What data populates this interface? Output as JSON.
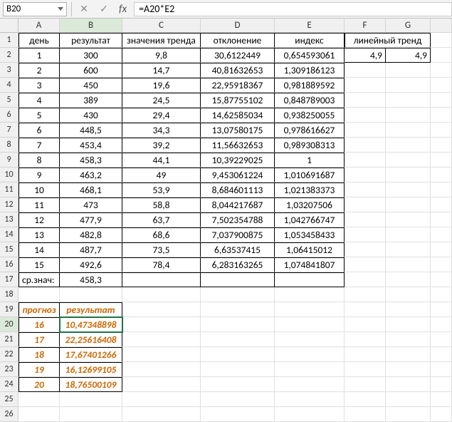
{
  "namebox": "B20",
  "fx_symbol": "fx",
  "cancel_icon": "✕",
  "confirm_icon": "✓",
  "formula": "=A20*E2",
  "col_letters": [
    "A",
    "B",
    "C",
    "D",
    "E",
    "F",
    "G",
    ""
  ],
  "header_row": [
    "день",
    "результат",
    "значения тренда",
    "отклонение",
    "индекс",
    "линейный тренд",
    ""
  ],
  "rows": [
    {
      "n": "1",
      "a": "1",
      "b": "300",
      "c": "9,8",
      "d": "30,6122449",
      "e": "0,654593061",
      "f": "4,9",
      "g": "4,9"
    },
    {
      "n": "2",
      "a": "2",
      "b": "600",
      "c": "14,7",
      "d": "40,81632653",
      "e": "1,309186123",
      "f": "",
      "g": ""
    },
    {
      "n": "3",
      "a": "3",
      "b": "450",
      "c": "19,6",
      "d": "22,95918367",
      "e": "0,981889592",
      "f": "",
      "g": ""
    },
    {
      "n": "4",
      "a": "4",
      "b": "389",
      "c": "24,5",
      "d": "15,87755102",
      "e": "0,848789003",
      "f": "",
      "g": ""
    },
    {
      "n": "5",
      "a": "5",
      "b": "430",
      "c": "29,4",
      "d": "14,62585034",
      "e": "0,938250055",
      "f": "",
      "g": ""
    },
    {
      "n": "6",
      "a": "6",
      "b": "448,5",
      "c": "34,3",
      "d": "13,07580175",
      "e": "0,978616627",
      "f": "",
      "g": ""
    },
    {
      "n": "7",
      "a": "7",
      "b": "453,4",
      "c": "39,2",
      "d": "11,56632653",
      "e": "0,989308313",
      "f": "",
      "g": ""
    },
    {
      "n": "8",
      "a": "8",
      "b": "458,3",
      "c": "44,1",
      "d": "10,39229025",
      "e": "1",
      "f": "",
      "g": ""
    },
    {
      "n": "9",
      "a": "9",
      "b": "463,2",
      "c": "49",
      "d": "9,453061224",
      "e": "1,010691687",
      "f": "",
      "g": ""
    },
    {
      "n": "10",
      "a": "10",
      "b": "468,1",
      "c": "53,9",
      "d": "8,684601113",
      "e": "1,021383373",
      "f": "",
      "g": ""
    },
    {
      "n": "11",
      "a": "11",
      "b": "473",
      "c": "58,8",
      "d": "8,044217687",
      "e": "1,03207506",
      "f": "",
      "g": ""
    },
    {
      "n": "12",
      "a": "12",
      "b": "477,9",
      "c": "63,7",
      "d": "7,502354788",
      "e": "1,042766747",
      "f": "",
      "g": ""
    },
    {
      "n": "13",
      "a": "13",
      "b": "482,8",
      "c": "68,6",
      "d": "7,037900875",
      "e": "1,053458433",
      "f": "",
      "g": ""
    },
    {
      "n": "14",
      "a": "14",
      "b": "487,7",
      "c": "73,5",
      "d": "6,63537415",
      "e": "1,06415012",
      "f": "",
      "g": ""
    },
    {
      "n": "15",
      "a": "15",
      "b": "492,6",
      "c": "78,4",
      "d": "6,283163265",
      "e": "1,074841807",
      "f": "",
      "g": ""
    }
  ],
  "avg_row": {
    "n": "17",
    "a": "ср.знач:",
    "b": "458,3"
  },
  "fc_header": {
    "n": "19",
    "a": "прогноз",
    "b": "результат"
  },
  "fc_rows": [
    {
      "n": "20",
      "a": "16",
      "b": "10,47348898"
    },
    {
      "n": "21",
      "a": "17",
      "b": "22,25616408"
    },
    {
      "n": "22",
      "a": "18",
      "b": "17,67401266"
    },
    {
      "n": "23",
      "a": "19",
      "b": "16,12699105"
    },
    {
      "n": "24",
      "a": "20",
      "b": "18,76500109"
    }
  ],
  "extra_rows": [
    "25",
    "26"
  ]
}
